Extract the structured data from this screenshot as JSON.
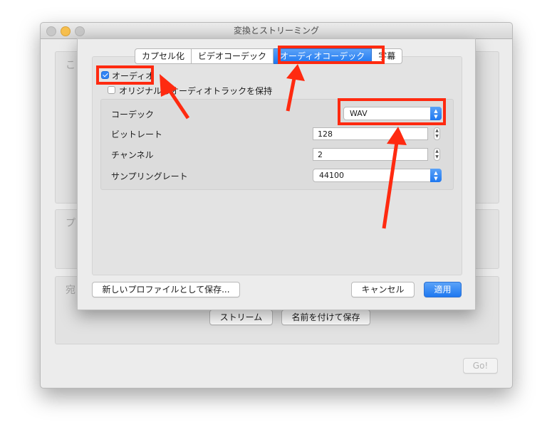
{
  "window": {
    "title": "変換とストリーミング",
    "bg_groups": [
      "こ",
      "プロ",
      "宛"
    ],
    "stream_button": "ストリーム",
    "save_as_button": "名前を付けて保存",
    "go_button": "Go!"
  },
  "sheet": {
    "tabs": [
      {
        "label": "カプセル化",
        "active": false
      },
      {
        "label": "ビデオコーデック",
        "active": false
      },
      {
        "label": "オーディオコーデック",
        "active": true
      },
      {
        "label": "字幕",
        "active": false
      }
    ],
    "audio_checkbox": {
      "label": "オーディオ",
      "checked": true
    },
    "keep_track_checkbox": {
      "label": "オリジナルのオーディオトラックを保持",
      "checked": false
    },
    "fields": {
      "codec": {
        "label": "コーデック",
        "value": "WAV"
      },
      "bitrate": {
        "label": "ビットレート",
        "value": "128"
      },
      "channels": {
        "label": "チャンネル",
        "value": "2"
      },
      "samplerate": {
        "label": "サンプリングレート",
        "value": "44100"
      }
    },
    "buttons": {
      "save_profile": "新しいプロファイルとして保存...",
      "cancel": "キャンセル",
      "apply": "適用"
    }
  },
  "colors": {
    "accent": "#1f78f0",
    "annotation": "#ff2a10"
  }
}
